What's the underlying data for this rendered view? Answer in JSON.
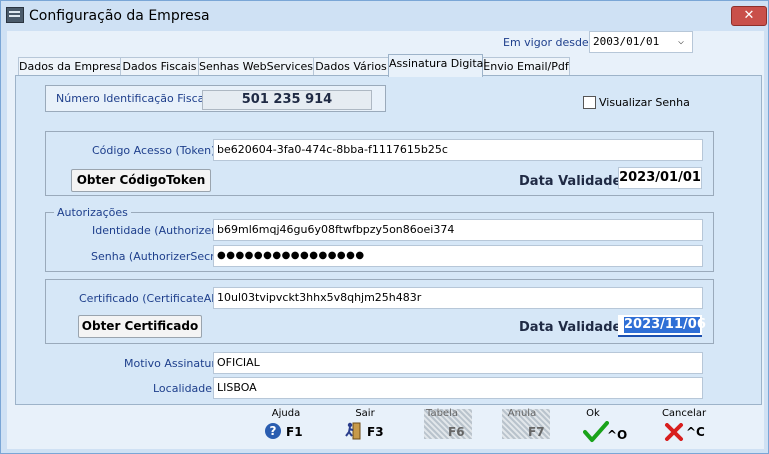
{
  "window": {
    "title": "Configuração da Empresa",
    "close_glyph": "✕"
  },
  "effective": {
    "label": "Em vigor desde :",
    "value": "2003/01/01"
  },
  "tabs": [
    "Dados da Empresa",
    "Dados Fiscais",
    "Senhas WebServices",
    "Dados Vários",
    "Assinatura Digital",
    "Envio Email/Pdf"
  ],
  "nif": {
    "label": "Número Identificação Fiscal",
    "value": "501 235 914"
  },
  "show_password": {
    "label": "Visualizar Senha",
    "checked": false
  },
  "token": {
    "label": "Código Acesso (Token):",
    "value": "be620604-3fa0-474c-8bba-f1117615b25c",
    "button": "Obter CódigoToken",
    "validity_label": "Data Validade:",
    "validity_value": "2023/01/01"
  },
  "authorizations": {
    "legend": "Autorizações",
    "id_label": "Identidade (AuthorizerID):",
    "id_value": "b69ml6mqj46gu6y08ftwfbpzy5on86oei374",
    "secret_label": "Senha (AuthorizerSecret):",
    "secret_value": "●●●●●●●●●●●●●●●●"
  },
  "certificate": {
    "label": "Certificado (CertificateAlias):",
    "value": "10ul03tvipvckt3hhx5v8qhjm25h483r",
    "button": "Obter Certificado",
    "validity_label": "Data Validade:",
    "validity_value": "2023/11/06"
  },
  "signature": {
    "reason_label": "Motivo Assinatura:",
    "reason_value": "OFICIAL",
    "location_label": "Localidade:",
    "location_value": "LISBOA"
  },
  "footer": [
    {
      "label": "Ajuda",
      "key": "F1",
      "icon": "help-icon",
      "enabled": true
    },
    {
      "label": "Sair",
      "key": "F3",
      "icon": "exit-icon",
      "enabled": true
    },
    {
      "label": "Tabela",
      "key": "F6",
      "icon": "table-icon",
      "enabled": false
    },
    {
      "label": "Anula",
      "key": "F7",
      "icon": "cancel-record-icon",
      "enabled": false
    },
    {
      "label": "Ok",
      "key": "^O",
      "icon": "check-icon",
      "enabled": true
    },
    {
      "label": "Cancelar",
      "key": "^C",
      "icon": "x-icon",
      "enabled": true
    }
  ],
  "colors": {
    "label_blue": "#1e3f8c",
    "ok_green": "#1aa31a",
    "cancel_red": "#d81e1e",
    "highlight": "#2f6fd6"
  }
}
